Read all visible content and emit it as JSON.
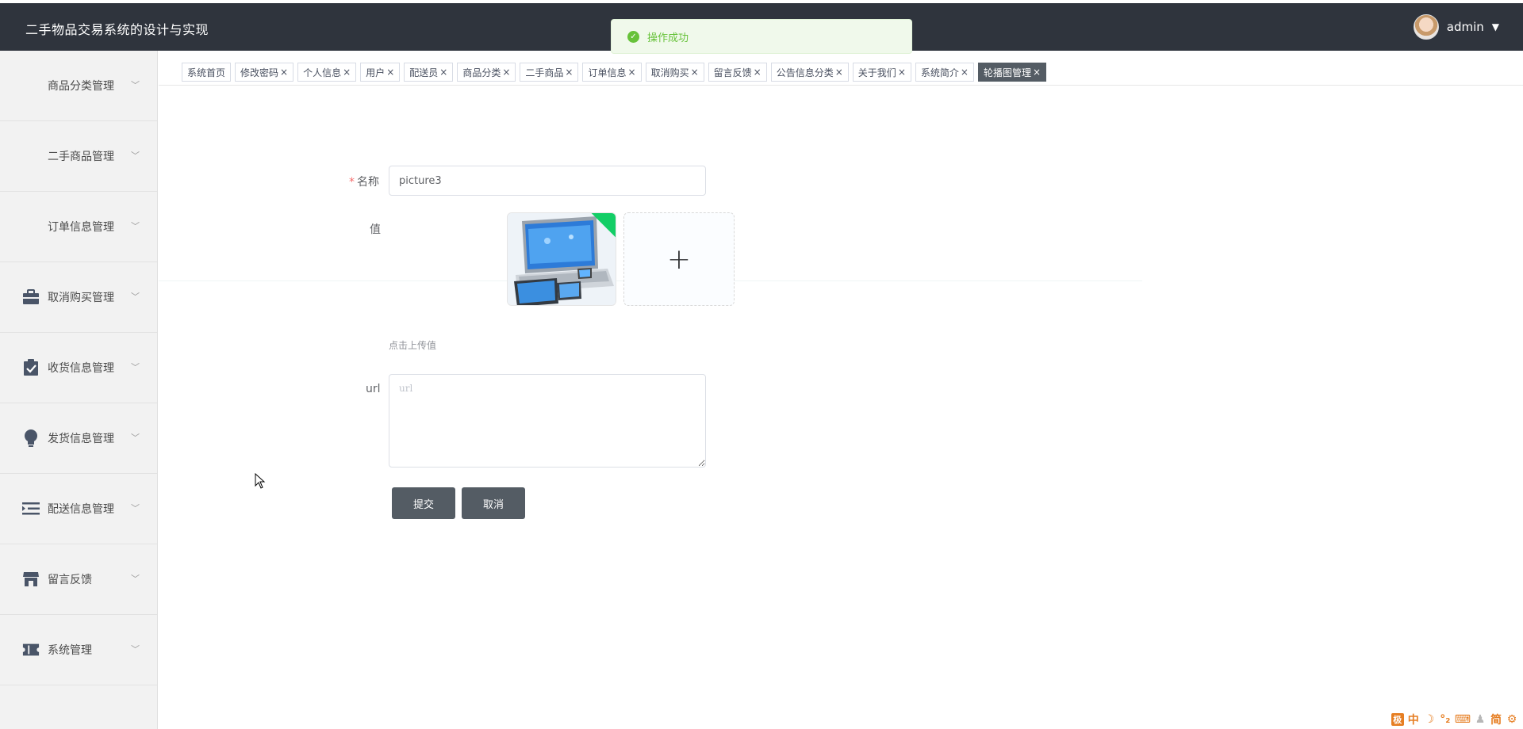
{
  "header": {
    "app_title": "二手物品交易系统的设计与实现",
    "user_name": "admin",
    "user_caret": "▼"
  },
  "toast": {
    "message": "操作成功",
    "icon": "check-circle-icon",
    "icon_glyph": "✓"
  },
  "sidebar": {
    "items": [
      {
        "label": "商品分类管理",
        "icon": "grid-icon"
      },
      {
        "label": "二手商品管理",
        "icon": "grid-icon"
      },
      {
        "label": "订单信息管理",
        "icon": "grid-icon"
      },
      {
        "label": "取消购买管理",
        "icon": "briefcase-icon"
      },
      {
        "label": "收货信息管理",
        "icon": "clipboard-check-icon"
      },
      {
        "label": "发货信息管理",
        "icon": "lightbulb-icon"
      },
      {
        "label": "配送信息管理",
        "icon": "list-indent-icon"
      },
      {
        "label": "留言反馈",
        "icon": "store-icon"
      },
      {
        "label": "系统管理",
        "icon": "ticket-icon"
      }
    ],
    "chevron": "﹀"
  },
  "tabs": [
    {
      "label": "系统首页",
      "closable": false,
      "active": false
    },
    {
      "label": "修改密码",
      "closable": true,
      "active": false
    },
    {
      "label": "个人信息",
      "closable": true,
      "active": false
    },
    {
      "label": "用户",
      "closable": true,
      "active": false
    },
    {
      "label": "配送员",
      "closable": true,
      "active": false
    },
    {
      "label": "商品分类",
      "closable": true,
      "active": false
    },
    {
      "label": "二手商品",
      "closable": true,
      "active": false
    },
    {
      "label": "订单信息",
      "closable": true,
      "active": false
    },
    {
      "label": "取消购买",
      "closable": true,
      "active": false
    },
    {
      "label": "留言反馈",
      "closable": true,
      "active": false
    },
    {
      "label": "公告信息分类",
      "closable": true,
      "active": false
    },
    {
      "label": "关于我们",
      "closable": true,
      "active": false
    },
    {
      "label": "系统简介",
      "closable": true,
      "active": false
    },
    {
      "label": "轮播图管理",
      "closable": true,
      "active": true
    }
  ],
  "tab_close_glyph": "×",
  "form": {
    "name_label": "名称",
    "name_required_mark": "*",
    "name_value": "picture3",
    "value_label": "值",
    "upload_plus": "+",
    "upload_tip": "点击上传值",
    "url_label": "url",
    "url_placeholder": "url",
    "url_value": "",
    "submit_label": "提交",
    "cancel_label": "取消"
  },
  "ime_tray": [
    "中",
    "☽",
    "°₂",
    "⌨",
    "♟",
    "简",
    "⚙"
  ],
  "ime_badge": "极",
  "colors": {
    "header_bg": "#2f343d",
    "accent": "#545c64",
    "success": "#67c23a",
    "upload_ok": "#13ce66"
  }
}
